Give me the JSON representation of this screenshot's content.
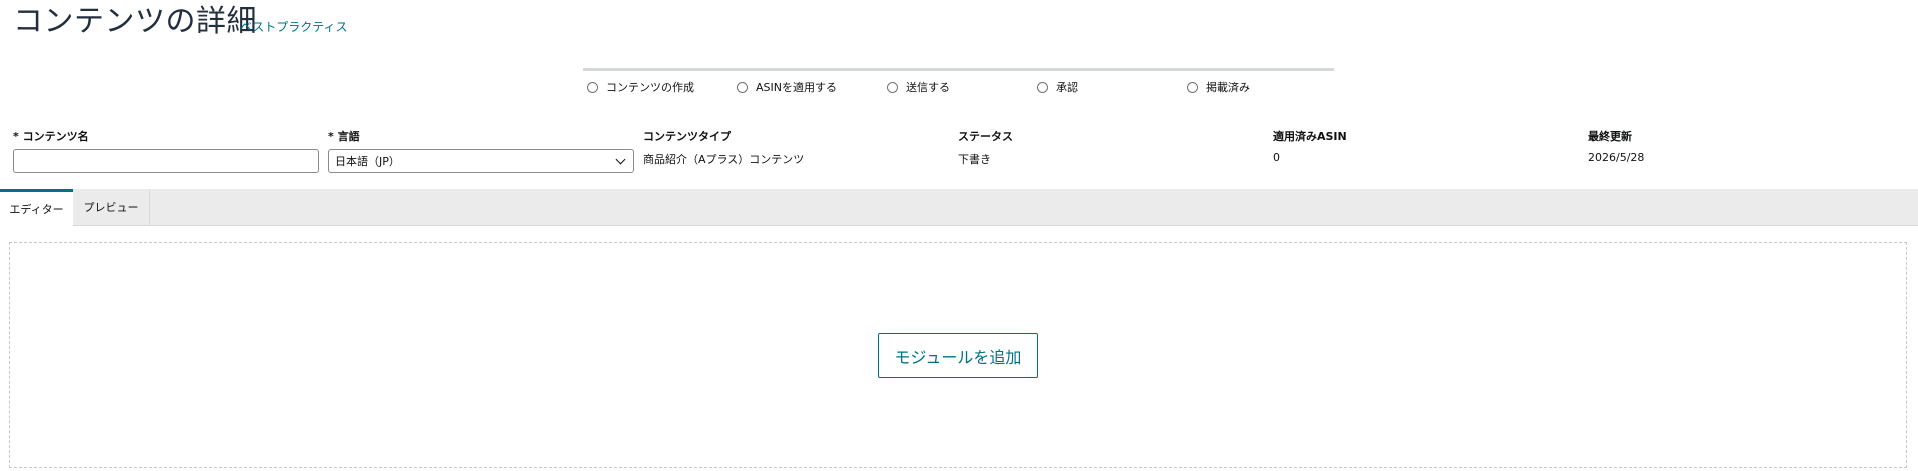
{
  "header": {
    "title": "コンテンツの詳細",
    "best_practices_link": "ベストプラクティス"
  },
  "stepper": {
    "steps": [
      {
        "label": "コンテンツの作成"
      },
      {
        "label": "ASINを適用する"
      },
      {
        "label": "送信する"
      },
      {
        "label": "承認"
      },
      {
        "label": "掲載済み"
      }
    ]
  },
  "fields": {
    "content_name": {
      "label": "* コンテンツ名",
      "value": "",
      "placeholder": ""
    },
    "language": {
      "label": "* 言語",
      "value": "日本語（JP）"
    },
    "content_type": {
      "label": "コンテンツタイプ",
      "value": "商品紹介（Aプラス）コンテンツ"
    },
    "status": {
      "label": "ステータス",
      "value": "下書き"
    },
    "applied_asin": {
      "label": "適用済みASIN",
      "value": "0"
    },
    "last_updated": {
      "label": "最終更新",
      "value": "2026/5/28"
    }
  },
  "tabs": [
    {
      "label": "エディター",
      "active": true
    },
    {
      "label": "プレビュー",
      "active": false
    }
  ],
  "editor": {
    "add_module_label": "モジュールを追加"
  },
  "colors": {
    "accent": "#007185",
    "title": "#232f3e",
    "tab_bar_bg": "#ebebeb"
  }
}
